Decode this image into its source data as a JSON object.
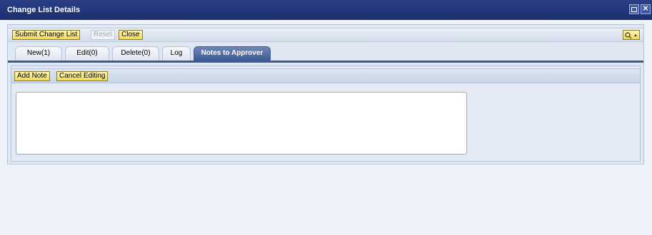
{
  "window": {
    "title": "Change List Details",
    "controls": [
      {
        "name": "maximize-icon"
      },
      {
        "name": "close-icon",
        "glyph": "✕"
      }
    ]
  },
  "toolbar": {
    "submit_label": "Submit Change List",
    "reset_label": "Reset",
    "close_label": "Close",
    "settings_icon": "personalize-icon"
  },
  "tabs": [
    {
      "label": "New(1)",
      "active": false
    },
    {
      "label": "Edit(0)",
      "active": false
    },
    {
      "label": "Delete(0)",
      "active": false
    },
    {
      "label": "Log",
      "active": false
    },
    {
      "label": "Notes to Approver",
      "active": true
    }
  ],
  "notes": {
    "add_note_label": "Add Note",
    "cancel_editing_label": "Cancel Editing",
    "text": ""
  },
  "colors": {
    "title_bar": "#1c2e6e",
    "active_tab": "#3e5a93",
    "button": "#f0d85a"
  }
}
